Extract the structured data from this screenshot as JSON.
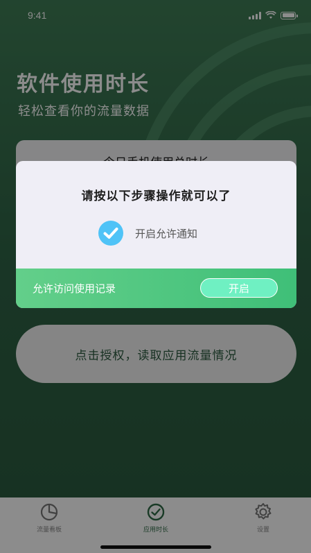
{
  "status_bar": {
    "time": "9:41"
  },
  "hero": {
    "title": "软件使用时长",
    "subtitle": "轻松查看你的流量数据"
  },
  "usage_card": {
    "title": "今日手机使用总时长"
  },
  "auth_button": {
    "label": "点击授权，读取应用流量情况"
  },
  "dialog": {
    "title": "请按以下步骤操作就可以了",
    "step_label": "开启允许通知",
    "footer_label": "允许访问使用记录",
    "open_button_label": "开启"
  },
  "tab_bar": {
    "items": [
      {
        "label": "流量看板",
        "icon": "pie-chart-icon"
      },
      {
        "label": "应用时长",
        "icon": "check-circle-icon"
      },
      {
        "label": "设置",
        "icon": "gear-icon"
      }
    ],
    "active_index": 1
  },
  "colors": {
    "bg_green": "#2f6446",
    "accent_green": "#3fbf78",
    "check_blue": "#4fc3f7",
    "open_button": "#6ff0c2"
  }
}
